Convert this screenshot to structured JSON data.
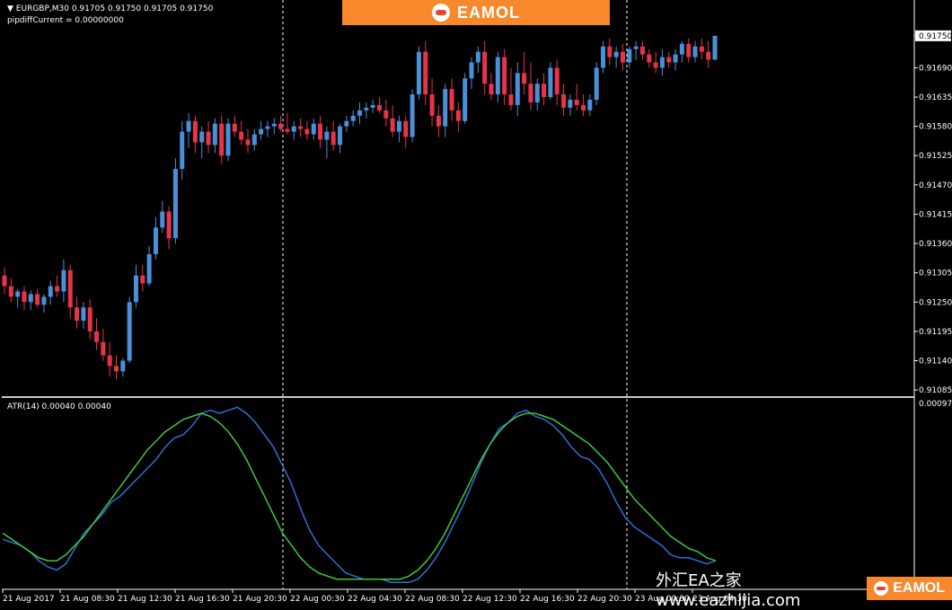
{
  "header": {
    "symbol_line": "EURGBP,M30  0.91705 0.91750 0.91705 0.91750",
    "indicator_line": "pipdiffCurrent = 0.00000000"
  },
  "brand": {
    "label": "EAMOL"
  },
  "atr": {
    "label": "ATR(14) 0.00040 0.00040",
    "axis_top": "0.00097"
  },
  "watermark": {
    "site": "外汇EA之家 www.eazhijia.com",
    "badge": "EAMOL"
  },
  "colors": {
    "bull": "#4a90d9",
    "bear": "#e8334a",
    "atr_line": "#2f6fd4",
    "signal_line": "#3ec93e",
    "grid": "#ffffff"
  },
  "chart_data": {
    "type": "candlestick",
    "price_axis_labels": [
      "0.91750",
      "0.91690",
      "0.91635",
      "0.91580",
      "0.91525",
      "0.91470",
      "0.91415",
      "0.91360",
      "0.91305",
      "0.91250",
      "0.91195",
      "0.91140",
      "0.91085"
    ],
    "current_price": "0.91750",
    "ylim": [
      0.91075,
      0.9177
    ],
    "time_labels": [
      "21 Aug 2017",
      "21 Aug 08:30",
      "21 Aug 12:30",
      "21 Aug 16:30",
      "21 Aug 20:30",
      "22 Aug 00:30",
      "22 Aug 04:30",
      "22 Aug 08:30",
      "22 Aug 12:30",
      "22 Aug 16:30",
      "22 Aug 20:30",
      "23 Aug 00:30",
      "23 Aug 04:30"
    ],
    "candles": [
      {
        "o": 0.913,
        "h": 0.91315,
        "l": 0.91265,
        "c": 0.9128
      },
      {
        "o": 0.9128,
        "h": 0.91295,
        "l": 0.9125,
        "c": 0.9126
      },
      {
        "o": 0.9126,
        "h": 0.91275,
        "l": 0.9124,
        "c": 0.9127
      },
      {
        "o": 0.9127,
        "h": 0.9128,
        "l": 0.91235,
        "c": 0.9125
      },
      {
        "o": 0.9125,
        "h": 0.91272,
        "l": 0.91235,
        "c": 0.91265
      },
      {
        "o": 0.91265,
        "h": 0.91275,
        "l": 0.9124,
        "c": 0.91245
      },
      {
        "o": 0.91245,
        "h": 0.91265,
        "l": 0.9123,
        "c": 0.9126
      },
      {
        "o": 0.9126,
        "h": 0.9129,
        "l": 0.91245,
        "c": 0.9128
      },
      {
        "o": 0.9128,
        "h": 0.913,
        "l": 0.9126,
        "c": 0.9127
      },
      {
        "o": 0.9127,
        "h": 0.9133,
        "l": 0.9125,
        "c": 0.9131
      },
      {
        "o": 0.9131,
        "h": 0.9132,
        "l": 0.9122,
        "c": 0.9124
      },
      {
        "o": 0.9124,
        "h": 0.9126,
        "l": 0.912,
        "c": 0.91215
      },
      {
        "o": 0.91215,
        "h": 0.9125,
        "l": 0.912,
        "c": 0.9124
      },
      {
        "o": 0.9124,
        "h": 0.91255,
        "l": 0.9118,
        "c": 0.91195
      },
      {
        "o": 0.91195,
        "h": 0.9122,
        "l": 0.9116,
        "c": 0.91175
      },
      {
        "o": 0.91175,
        "h": 0.912,
        "l": 0.9114,
        "c": 0.9115
      },
      {
        "o": 0.9115,
        "h": 0.91175,
        "l": 0.9111,
        "c": 0.9113
      },
      {
        "o": 0.9113,
        "h": 0.9115,
        "l": 0.91105,
        "c": 0.9112
      },
      {
        "o": 0.9112,
        "h": 0.91145,
        "l": 0.9111,
        "c": 0.9114
      },
      {
        "o": 0.9114,
        "h": 0.9126,
        "l": 0.91135,
        "c": 0.9125
      },
      {
        "o": 0.9125,
        "h": 0.9132,
        "l": 0.9124,
        "c": 0.913
      },
      {
        "o": 0.913,
        "h": 0.9132,
        "l": 0.9127,
        "c": 0.91285
      },
      {
        "o": 0.91285,
        "h": 0.91355,
        "l": 0.9128,
        "c": 0.9134
      },
      {
        "o": 0.9134,
        "h": 0.9141,
        "l": 0.9133,
        "c": 0.9139
      },
      {
        "o": 0.9139,
        "h": 0.9144,
        "l": 0.9138,
        "c": 0.9142
      },
      {
        "o": 0.9142,
        "h": 0.9143,
        "l": 0.9135,
        "c": 0.9137
      },
      {
        "o": 0.9137,
        "h": 0.9152,
        "l": 0.9136,
        "c": 0.915
      },
      {
        "o": 0.915,
        "h": 0.9159,
        "l": 0.9148,
        "c": 0.9157
      },
      {
        "o": 0.9157,
        "h": 0.91605,
        "l": 0.9154,
        "c": 0.9159
      },
      {
        "o": 0.9159,
        "h": 0.916,
        "l": 0.9153,
        "c": 0.9155
      },
      {
        "o": 0.9155,
        "h": 0.9158,
        "l": 0.9152,
        "c": 0.9157
      },
      {
        "o": 0.9157,
        "h": 0.9159,
        "l": 0.9153,
        "c": 0.91545
      },
      {
        "o": 0.91545,
        "h": 0.91595,
        "l": 0.9153,
        "c": 0.91585
      },
      {
        "o": 0.91585,
        "h": 0.916,
        "l": 0.9151,
        "c": 0.91525
      },
      {
        "o": 0.91525,
        "h": 0.91595,
        "l": 0.91515,
        "c": 0.91585
      },
      {
        "o": 0.91585,
        "h": 0.916,
        "l": 0.9156,
        "c": 0.9157
      },
      {
        "o": 0.9157,
        "h": 0.9159,
        "l": 0.91545,
        "c": 0.91555
      },
      {
        "o": 0.91555,
        "h": 0.91575,
        "l": 0.9153,
        "c": 0.91545
      },
      {
        "o": 0.91545,
        "h": 0.91575,
        "l": 0.91535,
        "c": 0.91565
      },
      {
        "o": 0.91565,
        "h": 0.9159,
        "l": 0.91555,
        "c": 0.91575
      },
      {
        "o": 0.91575,
        "h": 0.9159,
        "l": 0.9156,
        "c": 0.9158
      },
      {
        "o": 0.9158,
        "h": 0.91595,
        "l": 0.91565,
        "c": 0.91585
      },
      {
        "o": 0.91585,
        "h": 0.916,
        "l": 0.9157,
        "c": 0.91575
      },
      {
        "o": 0.91575,
        "h": 0.91605,
        "l": 0.91565,
        "c": 0.9157
      },
      {
        "o": 0.9157,
        "h": 0.9159,
        "l": 0.91555,
        "c": 0.9158
      },
      {
        "o": 0.9158,
        "h": 0.91595,
        "l": 0.9156,
        "c": 0.91575
      },
      {
        "o": 0.91575,
        "h": 0.9159,
        "l": 0.91555,
        "c": 0.91565
      },
      {
        "o": 0.91565,
        "h": 0.91595,
        "l": 0.91555,
        "c": 0.91585
      },
      {
        "o": 0.91585,
        "h": 0.916,
        "l": 0.9154,
        "c": 0.91555
      },
      {
        "o": 0.91555,
        "h": 0.9158,
        "l": 0.9152,
        "c": 0.9157
      },
      {
        "o": 0.9157,
        "h": 0.9159,
        "l": 0.91535,
        "c": 0.91545
      },
      {
        "o": 0.91545,
        "h": 0.91585,
        "l": 0.9153,
        "c": 0.9158
      },
      {
        "o": 0.9158,
        "h": 0.916,
        "l": 0.9157,
        "c": 0.9159
      },
      {
        "o": 0.9159,
        "h": 0.9161,
        "l": 0.9158,
        "c": 0.916
      },
      {
        "o": 0.916,
        "h": 0.91625,
        "l": 0.91585,
        "c": 0.9161
      },
      {
        "o": 0.9161,
        "h": 0.91625,
        "l": 0.91595,
        "c": 0.91615
      },
      {
        "o": 0.91615,
        "h": 0.9163,
        "l": 0.91605,
        "c": 0.9162
      },
      {
        "o": 0.9162,
        "h": 0.91635,
        "l": 0.91605,
        "c": 0.9161
      },
      {
        "o": 0.9161,
        "h": 0.9163,
        "l": 0.9158,
        "c": 0.91595
      },
      {
        "o": 0.91595,
        "h": 0.9162,
        "l": 0.9156,
        "c": 0.9157
      },
      {
        "o": 0.9157,
        "h": 0.916,
        "l": 0.9155,
        "c": 0.9159
      },
      {
        "o": 0.9159,
        "h": 0.916,
        "l": 0.9154,
        "c": 0.9156
      },
      {
        "o": 0.9156,
        "h": 0.9165,
        "l": 0.9155,
        "c": 0.9164
      },
      {
        "o": 0.9164,
        "h": 0.9173,
        "l": 0.9163,
        "c": 0.9172
      },
      {
        "o": 0.9172,
        "h": 0.9174,
        "l": 0.9162,
        "c": 0.9164
      },
      {
        "o": 0.9164,
        "h": 0.9167,
        "l": 0.9158,
        "c": 0.916
      },
      {
        "o": 0.916,
        "h": 0.9162,
        "l": 0.9156,
        "c": 0.9158
      },
      {
        "o": 0.9158,
        "h": 0.9166,
        "l": 0.9156,
        "c": 0.9165
      },
      {
        "o": 0.9165,
        "h": 0.9167,
        "l": 0.9159,
        "c": 0.9161
      },
      {
        "o": 0.9161,
        "h": 0.91625,
        "l": 0.9157,
        "c": 0.9159
      },
      {
        "o": 0.9159,
        "h": 0.9168,
        "l": 0.91585,
        "c": 0.9167
      },
      {
        "o": 0.9167,
        "h": 0.9171,
        "l": 0.9165,
        "c": 0.917
      },
      {
        "o": 0.917,
        "h": 0.9173,
        "l": 0.9168,
        "c": 0.9172
      },
      {
        "o": 0.9172,
        "h": 0.9174,
        "l": 0.9164,
        "c": 0.9166
      },
      {
        "o": 0.9166,
        "h": 0.9168,
        "l": 0.9163,
        "c": 0.9164
      },
      {
        "o": 0.9164,
        "h": 0.9172,
        "l": 0.91625,
        "c": 0.9171
      },
      {
        "o": 0.9171,
        "h": 0.91725,
        "l": 0.9162,
        "c": 0.9164
      },
      {
        "o": 0.9164,
        "h": 0.9169,
        "l": 0.9161,
        "c": 0.9162
      },
      {
        "o": 0.9162,
        "h": 0.917,
        "l": 0.916,
        "c": 0.9168
      },
      {
        "o": 0.9168,
        "h": 0.9172,
        "l": 0.9164,
        "c": 0.9166
      },
      {
        "o": 0.9166,
        "h": 0.917,
        "l": 0.9161,
        "c": 0.91625
      },
      {
        "o": 0.91625,
        "h": 0.9167,
        "l": 0.9161,
        "c": 0.9166
      },
      {
        "o": 0.9166,
        "h": 0.9168,
        "l": 0.9162,
        "c": 0.91635
      },
      {
        "o": 0.91635,
        "h": 0.917,
        "l": 0.9163,
        "c": 0.9169
      },
      {
        "o": 0.9169,
        "h": 0.91705,
        "l": 0.9162,
        "c": 0.9164
      },
      {
        "o": 0.9164,
        "h": 0.9166,
        "l": 0.916,
        "c": 0.91615
      },
      {
        "o": 0.91615,
        "h": 0.9164,
        "l": 0.916,
        "c": 0.9163
      },
      {
        "o": 0.9163,
        "h": 0.9166,
        "l": 0.9161,
        "c": 0.9162
      },
      {
        "o": 0.9162,
        "h": 0.9164,
        "l": 0.916,
        "c": 0.9161
      },
      {
        "o": 0.9161,
        "h": 0.9164,
        "l": 0.916,
        "c": 0.9163
      },
      {
        "o": 0.9163,
        "h": 0.917,
        "l": 0.9162,
        "c": 0.9169
      },
      {
        "o": 0.9169,
        "h": 0.9174,
        "l": 0.9168,
        "c": 0.9173
      },
      {
        "o": 0.9173,
        "h": 0.91745,
        "l": 0.91695,
        "c": 0.9171
      },
      {
        "o": 0.9171,
        "h": 0.9173,
        "l": 0.9169,
        "c": 0.9172
      },
      {
        "o": 0.9172,
        "h": 0.91735,
        "l": 0.91685,
        "c": 0.917
      },
      {
        "o": 0.917,
        "h": 0.9173,
        "l": 0.9169,
        "c": 0.91725
      },
      {
        "o": 0.91725,
        "h": 0.9174,
        "l": 0.91705,
        "c": 0.9173
      },
      {
        "o": 0.9173,
        "h": 0.9174,
        "l": 0.91705,
        "c": 0.91715
      },
      {
        "o": 0.91715,
        "h": 0.91725,
        "l": 0.9169,
        "c": 0.917
      },
      {
        "o": 0.917,
        "h": 0.9172,
        "l": 0.9168,
        "c": 0.9169
      },
      {
        "o": 0.9169,
        "h": 0.91725,
        "l": 0.91675,
        "c": 0.9171
      },
      {
        "o": 0.9171,
        "h": 0.9172,
        "l": 0.9169,
        "c": 0.917
      },
      {
        "o": 0.917,
        "h": 0.91725,
        "l": 0.91685,
        "c": 0.91715
      },
      {
        "o": 0.91715,
        "h": 0.9174,
        "l": 0.917,
        "c": 0.91735
      },
      {
        "o": 0.91735,
        "h": 0.91745,
        "l": 0.917,
        "c": 0.9171
      },
      {
        "o": 0.9171,
        "h": 0.9174,
        "l": 0.917,
        "c": 0.9173
      },
      {
        "o": 0.9173,
        "h": 0.91745,
        "l": 0.91705,
        "c": 0.9172
      },
      {
        "o": 0.9172,
        "h": 0.9174,
        "l": 0.9169,
        "c": 0.91705
      },
      {
        "o": 0.91705,
        "h": 0.9175,
        "l": 0.91705,
        "c": 0.9175
      }
    ],
    "atr_ylim": [
      0.00036,
      0.00098
    ],
    "atr": [
      0.00052,
      0.00051,
      0.0005,
      0.00048,
      0.00045,
      0.00043,
      0.00042,
      0.00044,
      0.00049,
      0.00054,
      0.00057,
      0.0006,
      0.00064,
      0.00066,
      0.00069,
      0.00072,
      0.00075,
      0.00078,
      0.00082,
      0.00085,
      0.00086,
      0.00089,
      0.00093,
      0.00094,
      0.00093,
      0.00094,
      0.00095,
      0.00093,
      0.0009,
      0.00086,
      0.00082,
      0.00076,
      0.0007,
      0.00062,
      0.00055,
      0.0005,
      0.00047,
      0.00044,
      0.00041,
      0.0004,
      0.00039,
      0.00039,
      0.00039,
      0.00038,
      0.00038,
      0.00038,
      0.00039,
      0.00042,
      0.00046,
      0.00051,
      0.00057,
      0.00063,
      0.0007,
      0.00077,
      0.00083,
      0.00088,
      0.0009,
      0.00093,
      0.00094,
      0.00092,
      0.00091,
      0.00089,
      0.00086,
      0.00082,
      0.00079,
      0.00078,
      0.00075,
      0.0007,
      0.00064,
      0.00059,
      0.00056,
      0.00054,
      0.00052,
      0.0005,
      0.00047,
      0.00046,
      0.00046,
      0.00045,
      0.00044,
      0.00045
    ],
    "atr_signal": [
      0.00054,
      0.00052,
      0.0005,
      0.00048,
      0.00046,
      0.00045,
      0.00045,
      0.00047,
      0.0005,
      0.00053,
      0.00057,
      0.00061,
      0.00065,
      0.00069,
      0.00073,
      0.00077,
      0.00081,
      0.00084,
      0.00087,
      0.00089,
      0.00091,
      0.00092,
      0.00093,
      0.00092,
      0.0009,
      0.00087,
      0.00083,
      0.00078,
      0.00072,
      0.00066,
      0.0006,
      0.00054,
      0.0005,
      0.00046,
      0.00043,
      0.00041,
      0.0004,
      0.00039,
      0.00039,
      0.00039,
      0.00039,
      0.00039,
      0.00039,
      0.00039,
      0.00039,
      0.0004,
      0.00042,
      0.00045,
      0.00049,
      0.00054,
      0.0006,
      0.00066,
      0.00072,
      0.00078,
      0.00083,
      0.00087,
      0.0009,
      0.00092,
      0.00093,
      0.00093,
      0.00092,
      0.00091,
      0.00089,
      0.00087,
      0.00085,
      0.00083,
      0.0008,
      0.00077,
      0.00073,
      0.00069,
      0.00065,
      0.00062,
      0.00059,
      0.00056,
      0.00053,
      0.00051,
      0.00049,
      0.00048,
      0.00046,
      0.00045
    ]
  }
}
